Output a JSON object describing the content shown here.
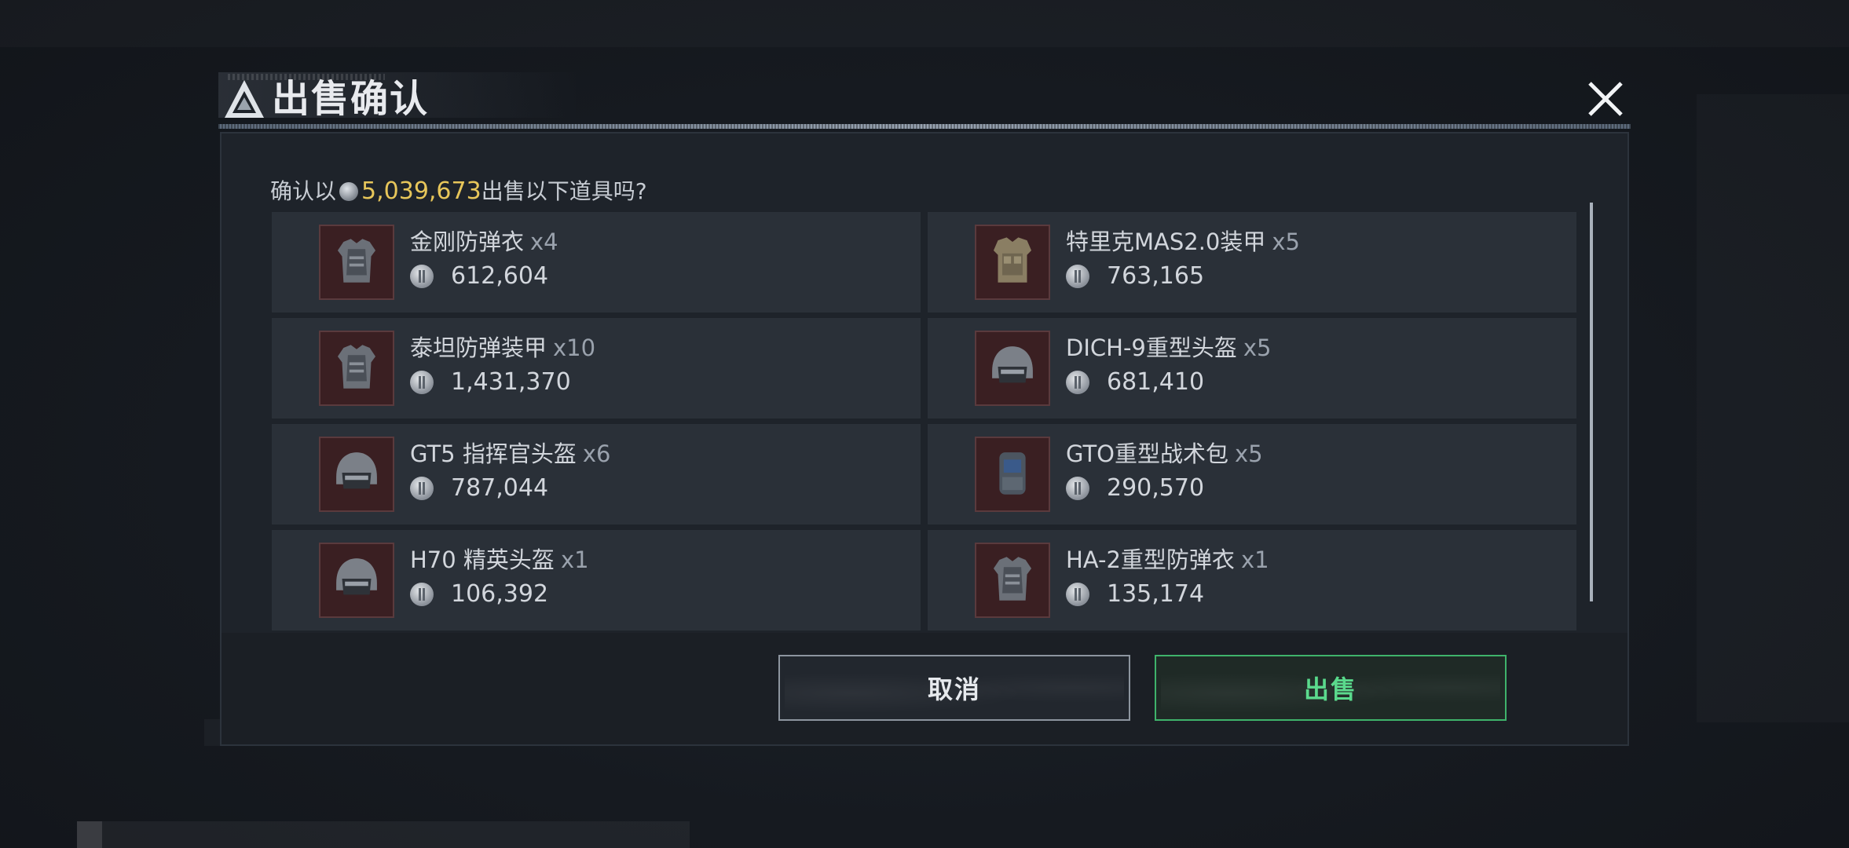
{
  "dialog": {
    "title": "出售确认",
    "prompt_prefix": "确认以",
    "total": "5,039,673",
    "prompt_suffix": "出售以下道具吗?"
  },
  "items": [
    {
      "name": "金刚防弹衣",
      "qty": "x4",
      "price": "612,604",
      "icon": "body-armor-icon"
    },
    {
      "name": "特里克MAS2.0装甲",
      "qty": "x5",
      "price": "763,165",
      "icon": "tactical-vest-icon"
    },
    {
      "name": "泰坦防弹装甲",
      "qty": "x10",
      "price": "1,431,370",
      "icon": "body-armor-icon"
    },
    {
      "name": "DICH-9重型头盔",
      "qty": "x5",
      "price": "681,410",
      "icon": "helmet-icon"
    },
    {
      "name": "GT5 指挥官头盔",
      "qty": "x6",
      "price": "787,044",
      "icon": "helmet-icon"
    },
    {
      "name": "GTO重型战术包",
      "qty": "x5",
      "price": "290,570",
      "icon": "backpack-icon"
    },
    {
      "name": "H70 精英头盔",
      "qty": "x1",
      "price": "106,392",
      "icon": "helmet-icon"
    },
    {
      "name": "HA-2重型防弹衣",
      "qty": "x1",
      "price": "135,174",
      "icon": "body-armor-icon"
    }
  ],
  "buttons": {
    "cancel": "取消",
    "sell": "出售"
  },
  "colors": {
    "gold": "#e7c65a",
    "sell_green": "#57d98a",
    "thumb_bg": "#3a1f22"
  }
}
